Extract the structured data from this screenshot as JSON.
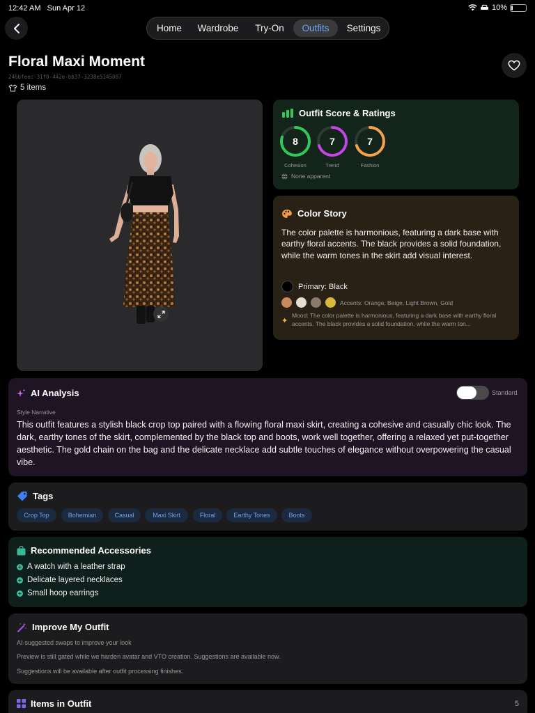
{
  "status": {
    "time": "12:42 AM",
    "date": "Sun Apr 12",
    "battery": "10%",
    "battery_level": 0.1
  },
  "nav": {
    "back_icon": "chevron-left-icon",
    "tabs": [
      {
        "label": "Home",
        "active": false
      },
      {
        "label": "Wardrobe",
        "active": false
      },
      {
        "label": "Try-On",
        "active": false
      },
      {
        "label": "Outfits",
        "active": true
      },
      {
        "label": "Settings",
        "active": false
      }
    ],
    "accent": "#6fa8ff"
  },
  "outfit": {
    "title": "Floral Maxi Moment",
    "id": "246bfeec-31f0-442e-bb37-3238e5145007",
    "item_count": "5 items",
    "favorite_icon": "heart-icon"
  },
  "scores": {
    "title": "Outfit Score & Ratings",
    "items": [
      {
        "label": "Cohesion",
        "value": "8",
        "score": 8,
        "max": 10,
        "color": "#34c759"
      },
      {
        "label": "Trend",
        "value": "7",
        "score": 7,
        "max": 10,
        "color": "#c445e6"
      },
      {
        "label": "Fashion",
        "value": "7",
        "score": 7,
        "max": 10,
        "color": "#f5a14a"
      }
    ],
    "occasion": "None apparent"
  },
  "color_story": {
    "title": "Color Story",
    "text": "The color palette is harmonious, featuring a dark base with earthy floral accents. The black provides a solid foundation, while the warm tones in the skirt add visual interest.",
    "primary_label": "Primary: Black",
    "primary_color": "#000000",
    "accents_label": "Accents: Orange, Beige, Light Brown, Gold",
    "accent_colors": [
      "#c98a5e",
      "#e6dccd",
      "#8a7a6b",
      "#d9b83c"
    ],
    "mood": "Mood: The color palette is harmonious, featuring a dark base with earthy floral accents. The black provides a solid foundation, while the warm ton..."
  },
  "ai_analysis": {
    "title": "AI Analysis",
    "mode_label": "Standard",
    "section_label": "Style Narrative",
    "narrative": "This outfit features a stylish black crop top paired with a flowing floral maxi skirt, creating a cohesive and casually chic look. The dark, earthy tones of the skirt, complemented by the black top and boots, work well together, offering a relaxed yet put-together aesthetic. The gold chain on the bag and the delicate necklace add subtle touches of elegance without overpowering the casual vibe."
  },
  "tags": {
    "title": "Tags",
    "items": [
      "Crop Top",
      "Bohemian",
      "Casual",
      "Maxi Skirt",
      "Floral",
      "Earthy Tones",
      "Boots"
    ]
  },
  "accessories": {
    "title": "Recommended Accessories",
    "items": [
      "A watch with a leather strap",
      "Delicate layered necklaces",
      "Small hoop earrings"
    ]
  },
  "improve": {
    "title": "Improve My Outfit",
    "subtitle": "AI-suggested swaps to improve your look",
    "note1": "Preview is still gated while we harden avatar and VTO creation. Suggestions are available now.",
    "note2": "Suggestions will be available after outfit processing finishes."
  },
  "items_in_outfit": {
    "title": "Items in Outfit",
    "count": "5"
  }
}
